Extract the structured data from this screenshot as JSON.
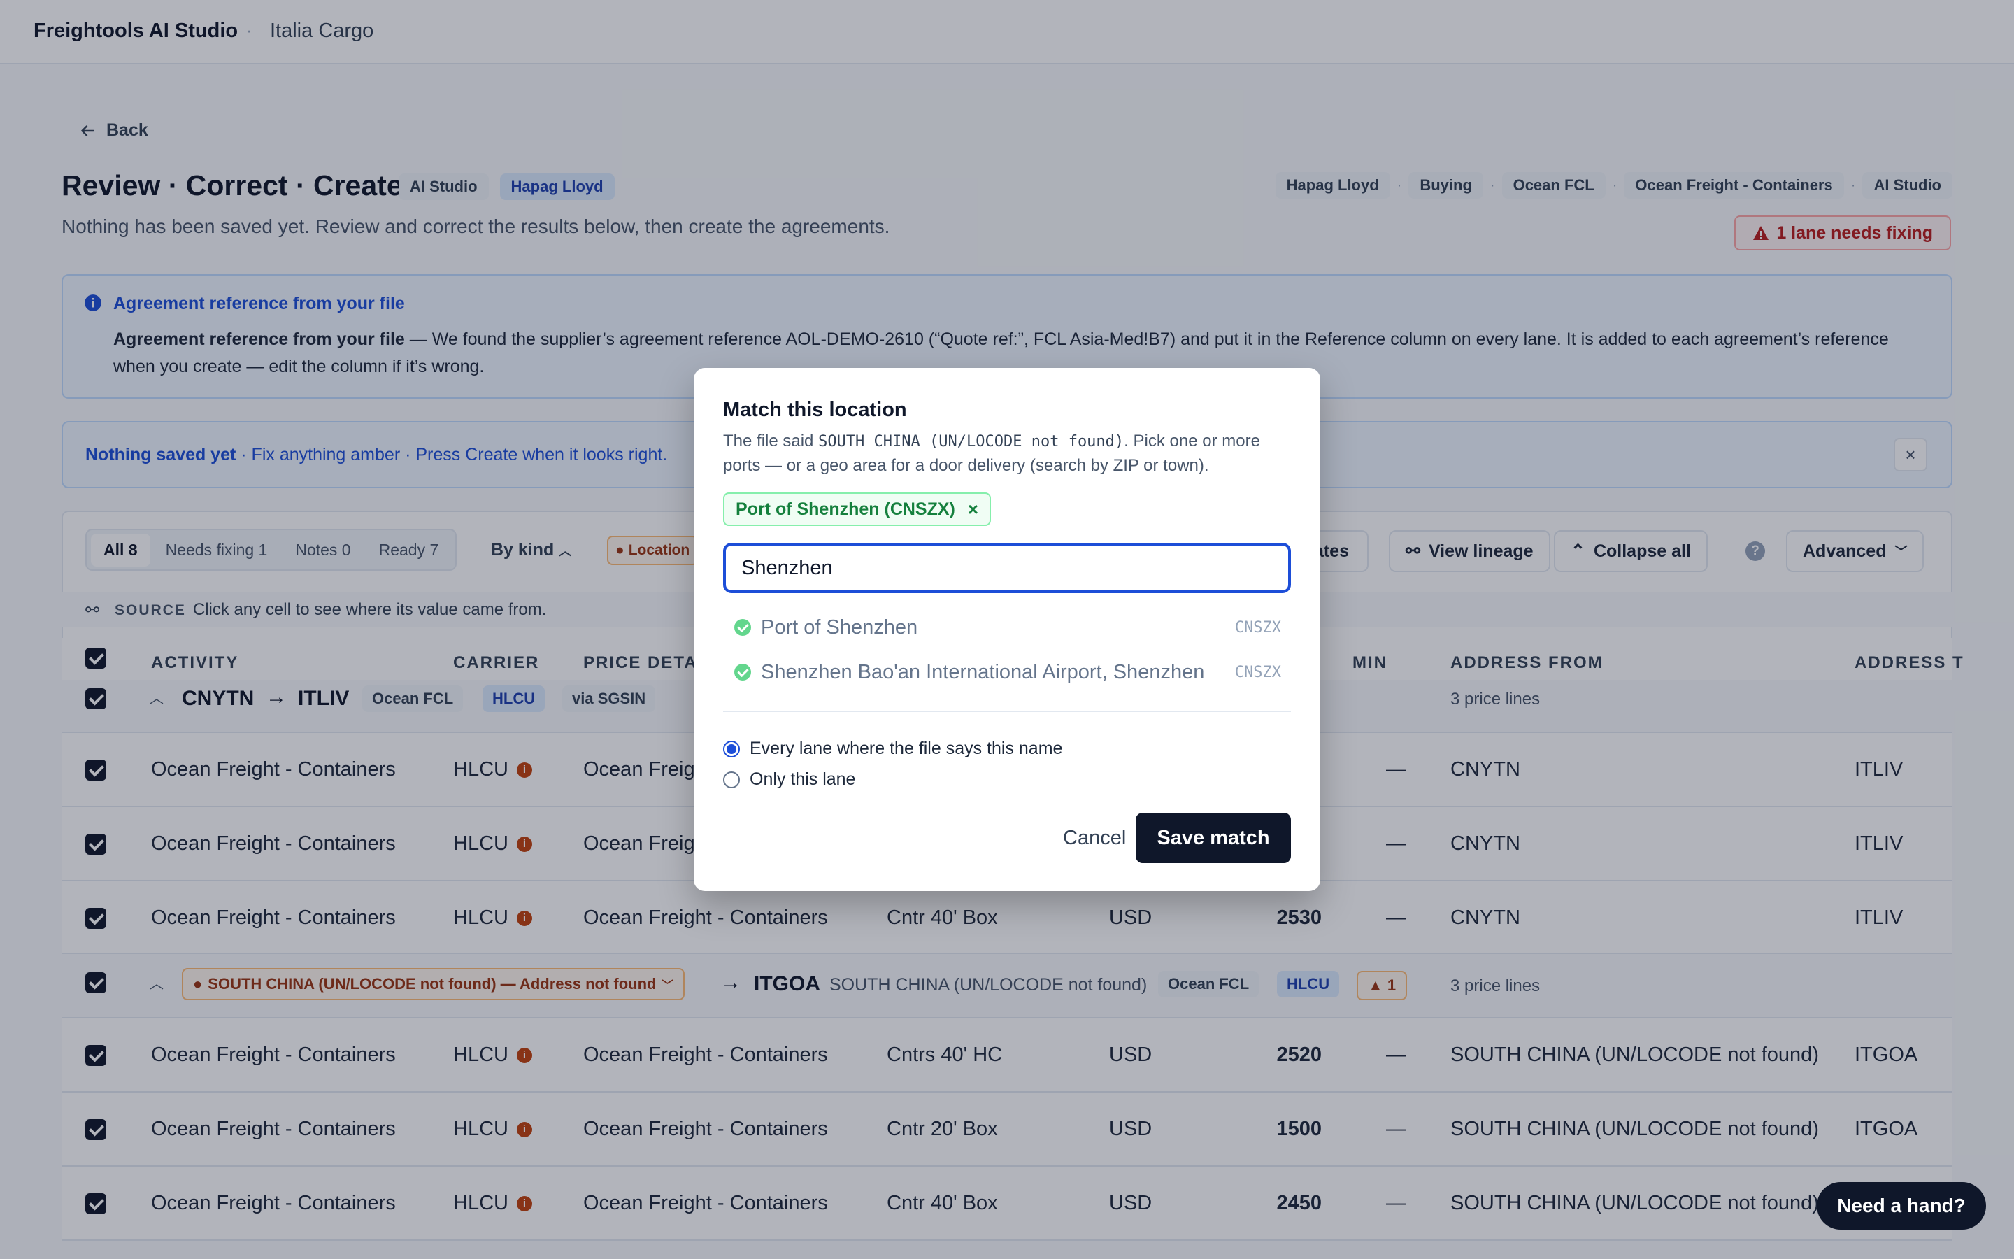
{
  "header": {
    "brand": "Freightools AI Studio",
    "separator": "·",
    "org": "Italia Cargo"
  },
  "back_label": "Back",
  "page": {
    "title": "Review · Correct · Create",
    "tags": [
      "AI Studio",
      "Hapag Lloyd"
    ],
    "subtitle": "Nothing has been saved yet. Review and correct the results below, then create the agreements.",
    "breadcrumbs": [
      "Hapag Lloyd",
      "Buying",
      "Ocean FCL",
      "Ocean Freight - Containers",
      "AI Studio"
    ],
    "breadcrumb_sep": "·",
    "warning": "1 lane needs fixing"
  },
  "info": {
    "title": "Agreement reference from your file",
    "body_bold": "Agreement reference from your file",
    "body": " — We found the supplier’s agreement reference AOL-DEMO-2610 (“Quote ref:”, FCL Asia-Med!B7) and put it in the Reference column on every lane. It is added to each agreement’s reference when you create — edit the column if it’s wrong."
  },
  "notice": {
    "bold": "Nothing saved yet",
    "rest": " · Fix anything amber · Press Create when it looks right.",
    "close": "×"
  },
  "toolbar": {
    "segments": [
      "All 8",
      "Needs fixing 1",
      "Notes 0",
      "Ready 7"
    ],
    "by_kind": "By kind",
    "location_pill": "Location",
    "templates_btn": "lates",
    "view_lineage": "View lineage",
    "collapse_all": "Collapse all",
    "help": "?",
    "advanced": "Advanced"
  },
  "source": {
    "label": "SOURCE",
    "text": "Click any cell to see where its value came from."
  },
  "table": {
    "headers": {
      "activity": "ACTIVITY",
      "carrier": "CARRIER",
      "price_detail": "PRICE DETAI",
      "min": "MIN",
      "address_from": "ADDRESS FROM",
      "address_to": "ADDRESS T"
    },
    "group1": {
      "from": "CNYTN",
      "to": "ITLIV",
      "kind": "Ocean FCL",
      "carrier": "HLCU",
      "via": "via SGSIN",
      "lines": "3 price lines"
    },
    "group1_rows": [
      {
        "activity": "Ocean Freight - Containers",
        "carrier": "HLCU",
        "price": "Ocean Freig",
        "unit": "",
        "cur": "",
        "amount": "",
        "min": "—",
        "from": "CNYTN",
        "to": "ITLIV"
      },
      {
        "activity": "Ocean Freight - Containers",
        "carrier": "HLCU",
        "price": "Ocean Freig",
        "unit": "",
        "cur": "",
        "amount": "",
        "min": "—",
        "from": "CNYTN",
        "to": "ITLIV"
      },
      {
        "activity": "Ocean Freight - Containers",
        "carrier": "HLCU",
        "price": "Ocean Freight - Containers",
        "unit": "Cntr 40' Box",
        "cur": "USD",
        "amount": "2530",
        "min": "—",
        "from": "CNYTN",
        "to": "ITLIV"
      }
    ],
    "group2": {
      "from_pill": "SOUTH CHINA (UN/LOCODE not found) — Address not found",
      "to": "ITGOA",
      "from_raw": "SOUTH CHINA (UN/LOCODE not found)",
      "kind": "Ocean FCL",
      "carrier": "HLCU",
      "warn": "1",
      "lines": "3 price lines"
    },
    "group2_rows": [
      {
        "activity": "Ocean Freight - Containers",
        "carrier": "HLCU",
        "price": "Ocean Freight - Containers",
        "unit": "Cntrs 40' HC",
        "cur": "USD",
        "amount": "2520",
        "min": "—",
        "from": "SOUTH CHINA (UN/LOCODE not found)",
        "to": "ITGOA"
      },
      {
        "activity": "Ocean Freight - Containers",
        "carrier": "HLCU",
        "price": "Ocean Freight - Containers",
        "unit": "Cntr 20' Box",
        "cur": "USD",
        "amount": "1500",
        "min": "—",
        "from": "SOUTH CHINA (UN/LOCODE not found)",
        "to": "ITGOA"
      },
      {
        "activity": "Ocean Freight - Containers",
        "carrier": "HLCU",
        "price": "Ocean Freight - Containers",
        "unit": "Cntr 40' Box",
        "cur": "USD",
        "amount": "2450",
        "min": "—",
        "from": "SOUTH CHINA (UN/LOCODE not found)",
        "to": "ITGOA"
      }
    ]
  },
  "modal": {
    "title": "Match this location",
    "desc_pre": "The file said ",
    "desc_code": "SOUTH CHINA (UN/LOCODE not found)",
    "desc_post": ". Pick one or more ports — or a geo area for a door delivery (search by ZIP or town).",
    "chip": "Port of Shenzhen (CNSZX)",
    "chip_close": "×",
    "search_value": "Shenzhen",
    "options": [
      {
        "name": "Port of Shenzhen",
        "code": "CNSZX"
      },
      {
        "name": "Shenzhen Bao'an International Airport, Shenzhen",
        "code": "CNSZX"
      }
    ],
    "scope_options": [
      "Every lane where the file says this name",
      "Only this lane"
    ],
    "cancel": "Cancel",
    "save": "Save match"
  },
  "help_button": "Need a hand?",
  "colors": {
    "primary": "#0f172a",
    "accent": "#1d4ed8",
    "warning": "#b91c1c",
    "amber": "#c2410c",
    "success": "#15803d"
  }
}
